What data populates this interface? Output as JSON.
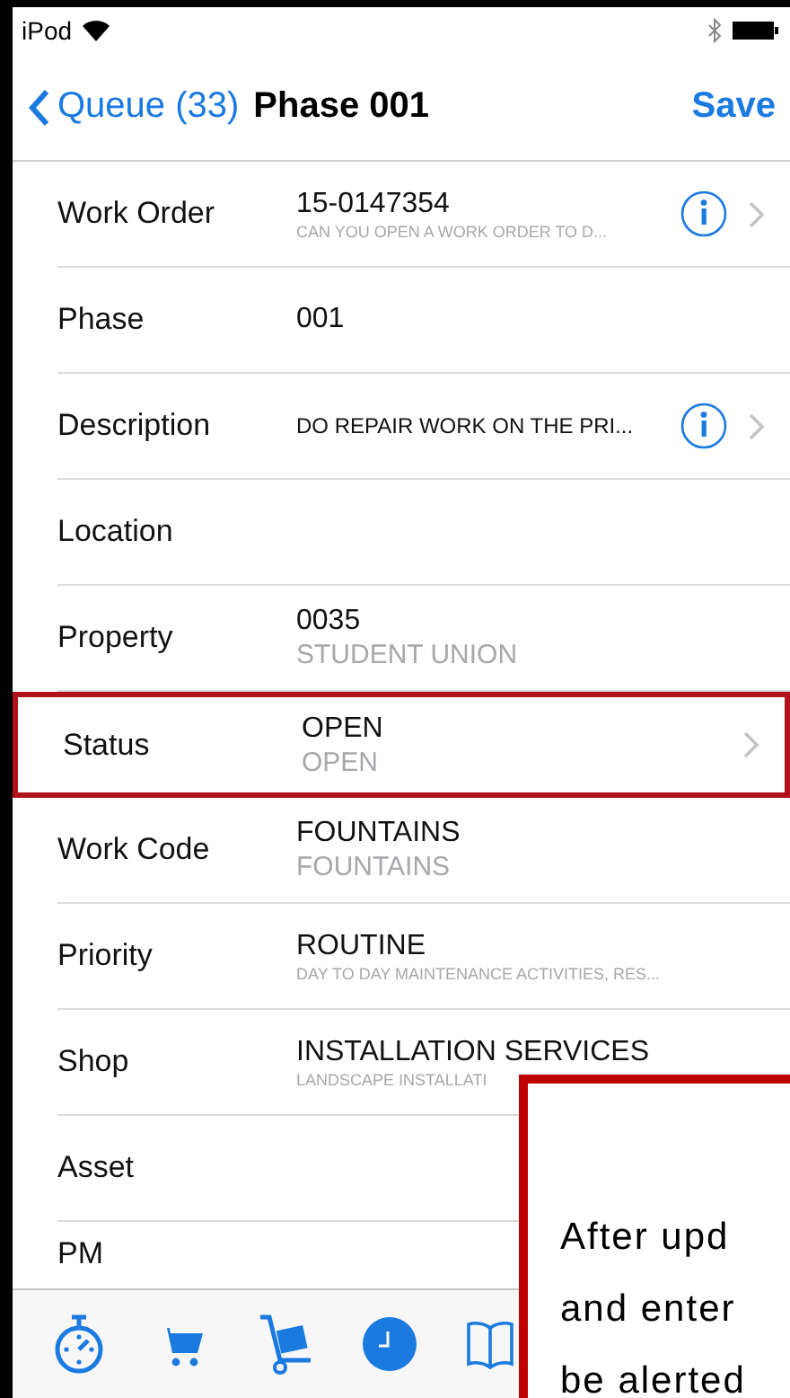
{
  "status_bar": {
    "carrier": "iPod"
  },
  "nav": {
    "back": "Queue (33)",
    "title": "Phase 001",
    "action": "Save"
  },
  "rows": [
    {
      "kind": "text",
      "label": "Work Order",
      "value": "15-0147354",
      "subtitle": "CAN YOU OPEN A WORK ORDER TO D...",
      "info": true,
      "chevron": true,
      "highlighted": false
    },
    {
      "kind": "text",
      "label": "Phase",
      "value": "001",
      "info": false,
      "chevron": false,
      "highlighted": false
    },
    {
      "kind": "compact",
      "label": "Description",
      "value": "DO REPAIR WORK ON THE PRI...",
      "info": true,
      "chevron": true,
      "highlighted": false
    },
    {
      "kind": "text",
      "label": "Location",
      "info": false,
      "chevron": false,
      "highlighted": false
    },
    {
      "kind": "text",
      "label": "Property",
      "value": "0035",
      "subtitle": "STUDENT UNION",
      "info": false,
      "chevron": false,
      "highlighted": false
    },
    {
      "kind": "text",
      "label": "Status",
      "value": "OPEN",
      "subtitle": "OPEN",
      "info": false,
      "chevron": true,
      "highlighted": true
    },
    {
      "kind": "text",
      "label": "Work Code",
      "value": "FOUNTAINS",
      "subtitle": "FOUNTAINS",
      "info": false,
      "chevron": false,
      "highlighted": false
    },
    {
      "kind": "text",
      "label": "Priority",
      "value": "ROUTINE",
      "subtitle": "DAY TO DAY MAINTENANCE ACTIVITIES, RES...",
      "info": false,
      "chevron": false,
      "highlighted": false
    },
    {
      "kind": "text",
      "label": "Shop",
      "value": "INSTALLATION SERVICES",
      "subtitle": "LANDSCAPE INSTALLATI",
      "info": false,
      "chevron": false,
      "highlighted": false
    },
    {
      "kind": "text",
      "label": "Asset",
      "info": false,
      "chevron": false,
      "highlighted": false
    },
    {
      "kind": "text",
      "label": "PM",
      "info": false,
      "chevron": false,
      "highlighted": false
    }
  ],
  "tab_bar": [
    {
      "kind": "stopwatch"
    },
    {
      "kind": "cart"
    },
    {
      "kind": "hand_truck"
    },
    {
      "kind": "clock"
    },
    {
      "kind": "book"
    }
  ],
  "callout": {
    "lines": [
      "After upd",
      "and enter",
      "be alerted"
    ]
  }
}
